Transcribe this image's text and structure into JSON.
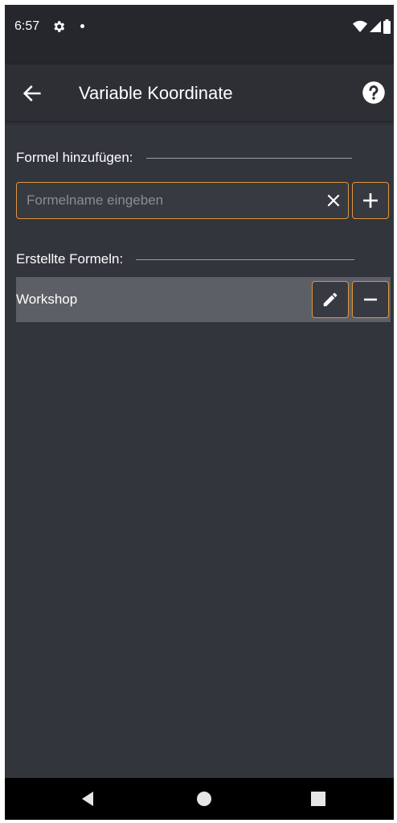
{
  "status_bar": {
    "time": "6:57",
    "icons": [
      "settings-icon",
      "notification-dot",
      "wifi-icon",
      "signal-icon",
      "battery-icon"
    ]
  },
  "app_bar": {
    "title": "Variable Koordinate",
    "back_icon": "arrow-left-icon",
    "help_icon": "help-circle-icon"
  },
  "add_section": {
    "heading": "Formel hinzufügen:",
    "input_value": "",
    "input_placeholder": "Formelname eingeben",
    "clear_icon": "close-icon",
    "add_icon": "plus-icon"
  },
  "list_section": {
    "heading": "Erstellte Formeln:",
    "items": [
      {
        "name": "Workshop",
        "edit_icon": "pencil-icon",
        "remove_icon": "minus-icon"
      }
    ]
  },
  "nav_bar": {
    "icons": [
      "back-triangle-icon",
      "home-circle-icon",
      "recents-square-icon"
    ]
  },
  "colors": {
    "background": "#33353d",
    "app_bar": "#2d2f35",
    "status_bar": "#26272c",
    "accent": "#e0953a",
    "list_row": "#5d5f66",
    "text": "#ffffff",
    "placeholder": "#8b8d94"
  }
}
